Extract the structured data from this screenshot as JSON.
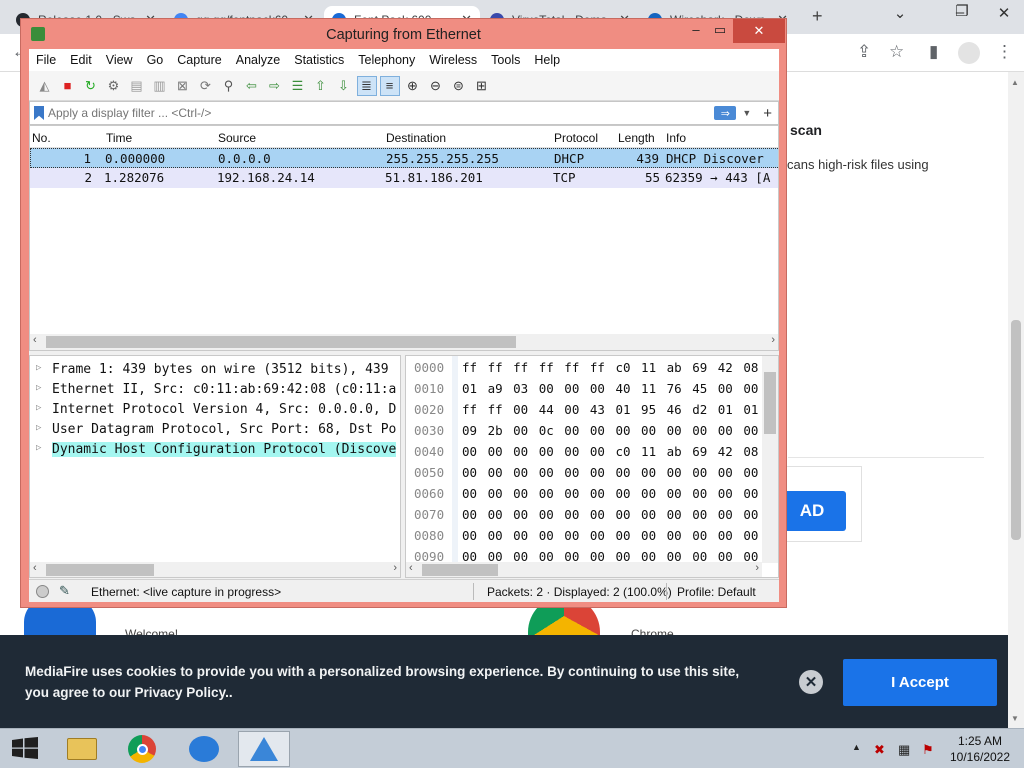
{
  "browser": {
    "tabs": [
      {
        "label": "Release 1.0 · Swa",
        "color": "#24292f"
      },
      {
        "label": "gg.gg/fontpack60",
        "color": "#4285f4"
      },
      {
        "label": "Font Pack 600",
        "color": "#1a6ad6"
      },
      {
        "label": "VirusTotal - Doma",
        "color": "#3949ab"
      },
      {
        "label": "Wireshark · Down",
        "color": "#1565c0"
      }
    ],
    "new_tab": "+",
    "close_glyph": "✕"
  },
  "page": {
    "scan_heading": "scan",
    "scan_desc": "cans high-risk files using",
    "download_btn": "AD",
    "welcome": "Welcome!",
    "chrome": "Chrome"
  },
  "cookie": {
    "text": "MediaFire uses cookies to provide you with a personalized browsing experience. By continuing to use this site, you agree to our Privacy Policy..",
    "accept": "I Accept",
    "close": "✕"
  },
  "wireshark": {
    "title": "Capturing from Ethernet",
    "menus": [
      "File",
      "Edit",
      "View",
      "Go",
      "Capture",
      "Analyze",
      "Statistics",
      "Telephony",
      "Wireless",
      "Tools",
      "Help"
    ],
    "filter_placeholder": "Apply a display filter ... <Ctrl-/>",
    "columns": [
      "No.",
      "Time",
      "Source",
      "Destination",
      "Protocol",
      "Length",
      "Info"
    ],
    "packets": [
      {
        "no": "1",
        "time": "0.000000",
        "src": "0.0.0.0",
        "dst": "255.255.255.255",
        "proto": "DHCP",
        "len": "439",
        "info": "DHCP Discover"
      },
      {
        "no": "2",
        "time": "1.282076",
        "src": "192.168.24.14",
        "dst": "51.81.186.201",
        "proto": "TCP",
        "len": "55",
        "info": "62359 → 443 [A"
      }
    ],
    "details": [
      "Frame 1: 439 bytes on wire (3512 bits), 439",
      "Ethernet II, Src: c0:11:ab:69:42:08 (c0:11:a",
      "Internet Protocol Version 4, Src: 0.0.0.0, D",
      "User Datagram Protocol, Src Port: 68, Dst Po",
      "Dynamic Host Configuration Protocol (Discove"
    ],
    "hex": [
      {
        "off": "0000",
        "bytes": "ff ff ff ff ff ff c0 11  ab 69 42 08 0"
      },
      {
        "off": "0010",
        "bytes": "01 a9 03 00 00 00 40 11  76 45 00 00 0"
      },
      {
        "off": "0020",
        "bytes": "ff ff 00 44 00 43 01 95  46 d2 01 01 0"
      },
      {
        "off": "0030",
        "bytes": "09 2b 00 0c 00 00 00 00  00 00 00 00 0"
      },
      {
        "off": "0040",
        "bytes": "00 00 00 00 00 00 c0 11  ab 69 42 08 0"
      },
      {
        "off": "0050",
        "bytes": "00 00 00 00 00 00 00 00  00 00 00 00 0"
      },
      {
        "off": "0060",
        "bytes": "00 00 00 00 00 00 00 00  00 00 00 00 0"
      },
      {
        "off": "0070",
        "bytes": "00 00 00 00 00 00 00 00  00 00 00 00 0"
      },
      {
        "off": "0080",
        "bytes": "00 00 00 00 00 00 00 00  00 00 00 00 0"
      },
      {
        "off": "0090",
        "bytes": "00 00 00 00 00 00 00 00  00 00 00 00 0"
      }
    ],
    "status": {
      "interface": "Ethernet: <live capture in progress>",
      "packets": "Packets: 2 · Displayed: 2 (100.0%)",
      "profile": "Profile: Default"
    }
  },
  "taskbar": {
    "time": "1:25 AM",
    "date": "10/16/2022"
  }
}
